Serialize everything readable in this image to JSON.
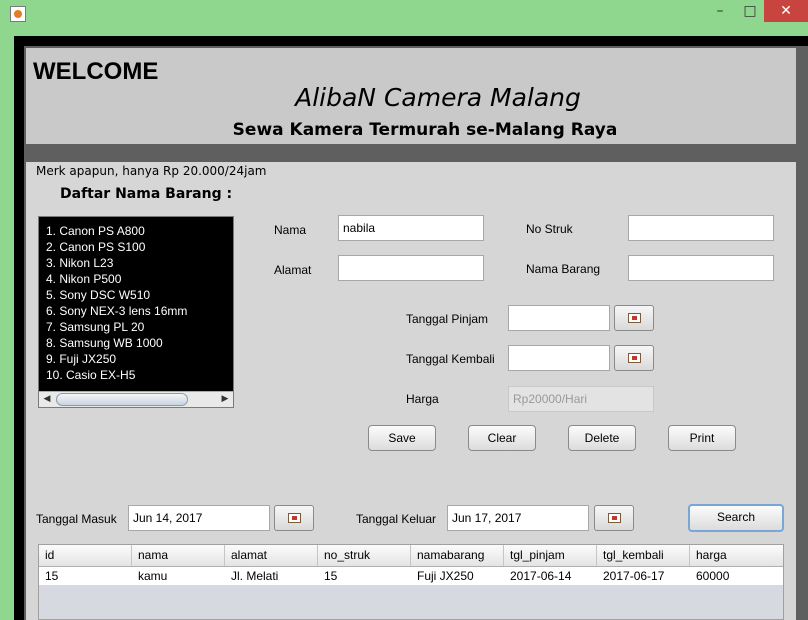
{
  "window": {
    "min_glyph": "–",
    "max_glyph": "□",
    "close_glyph": "✕"
  },
  "header": {
    "welcome": "WELCOME",
    "shop_name": "AlibaN Camera Malang",
    "tagline": "Sewa Kamera Termurah se-Malang Raya"
  },
  "info": {
    "merk_note": "Merk apapun, hanya Rp 20.000/24jam",
    "list_title": "Daftar Nama Barang :"
  },
  "items": [
    "1. Canon PS A800",
    "2. Canon PS S100",
    "3. Nikon L23",
    "4. Nikon P500",
    "5. Sony DSC W510",
    "6. Sony NEX-3 lens 16mm",
    "7. Samsung PL 20",
    "8. Samsung WB 1000",
    "9. Fuji JX250",
    "10. Casio EX-H5"
  ],
  "scroll": {
    "left_arrow": "◀",
    "right_arrow": "▶"
  },
  "form": {
    "nama_label": "Nama",
    "nama_value": "nabila",
    "alamat_label": "Alamat",
    "alamat_value": "",
    "no_struk_label": "No Struk",
    "no_struk_value": "",
    "nama_barang_label": "Nama Barang",
    "nama_barang_value": "",
    "tanggal_pinjam_label": "Tanggal Pinjam",
    "tanggal_pinjam_value": "",
    "tanggal_kembali_label": "Tanggal Kembali",
    "tanggal_kembali_value": "",
    "harga_label": "Harga",
    "harga_placeholder": "Rp20000/Hari"
  },
  "buttons": {
    "save": "Save",
    "clear": "Clear",
    "delete": "Delete",
    "print": "Print",
    "search": "Search"
  },
  "filter": {
    "tanggal_masuk_label": "Tanggal Masuk",
    "tanggal_masuk_value": "Jun 14, 2017",
    "tanggal_keluar_label": "Tanggal Keluar",
    "tanggal_keluar_value": "Jun 17, 2017"
  },
  "table": {
    "columns": [
      "id",
      "nama",
      "alamat",
      "no_struk",
      "namabarang",
      "tgl_pinjam",
      "tgl_kembali",
      "harga"
    ],
    "rows": [
      [
        "15",
        "kamu",
        "Jl. Melati",
        "15",
        "Fuji JX250",
        "2017-06-14",
        "2017-06-17",
        "60000"
      ]
    ]
  }
}
